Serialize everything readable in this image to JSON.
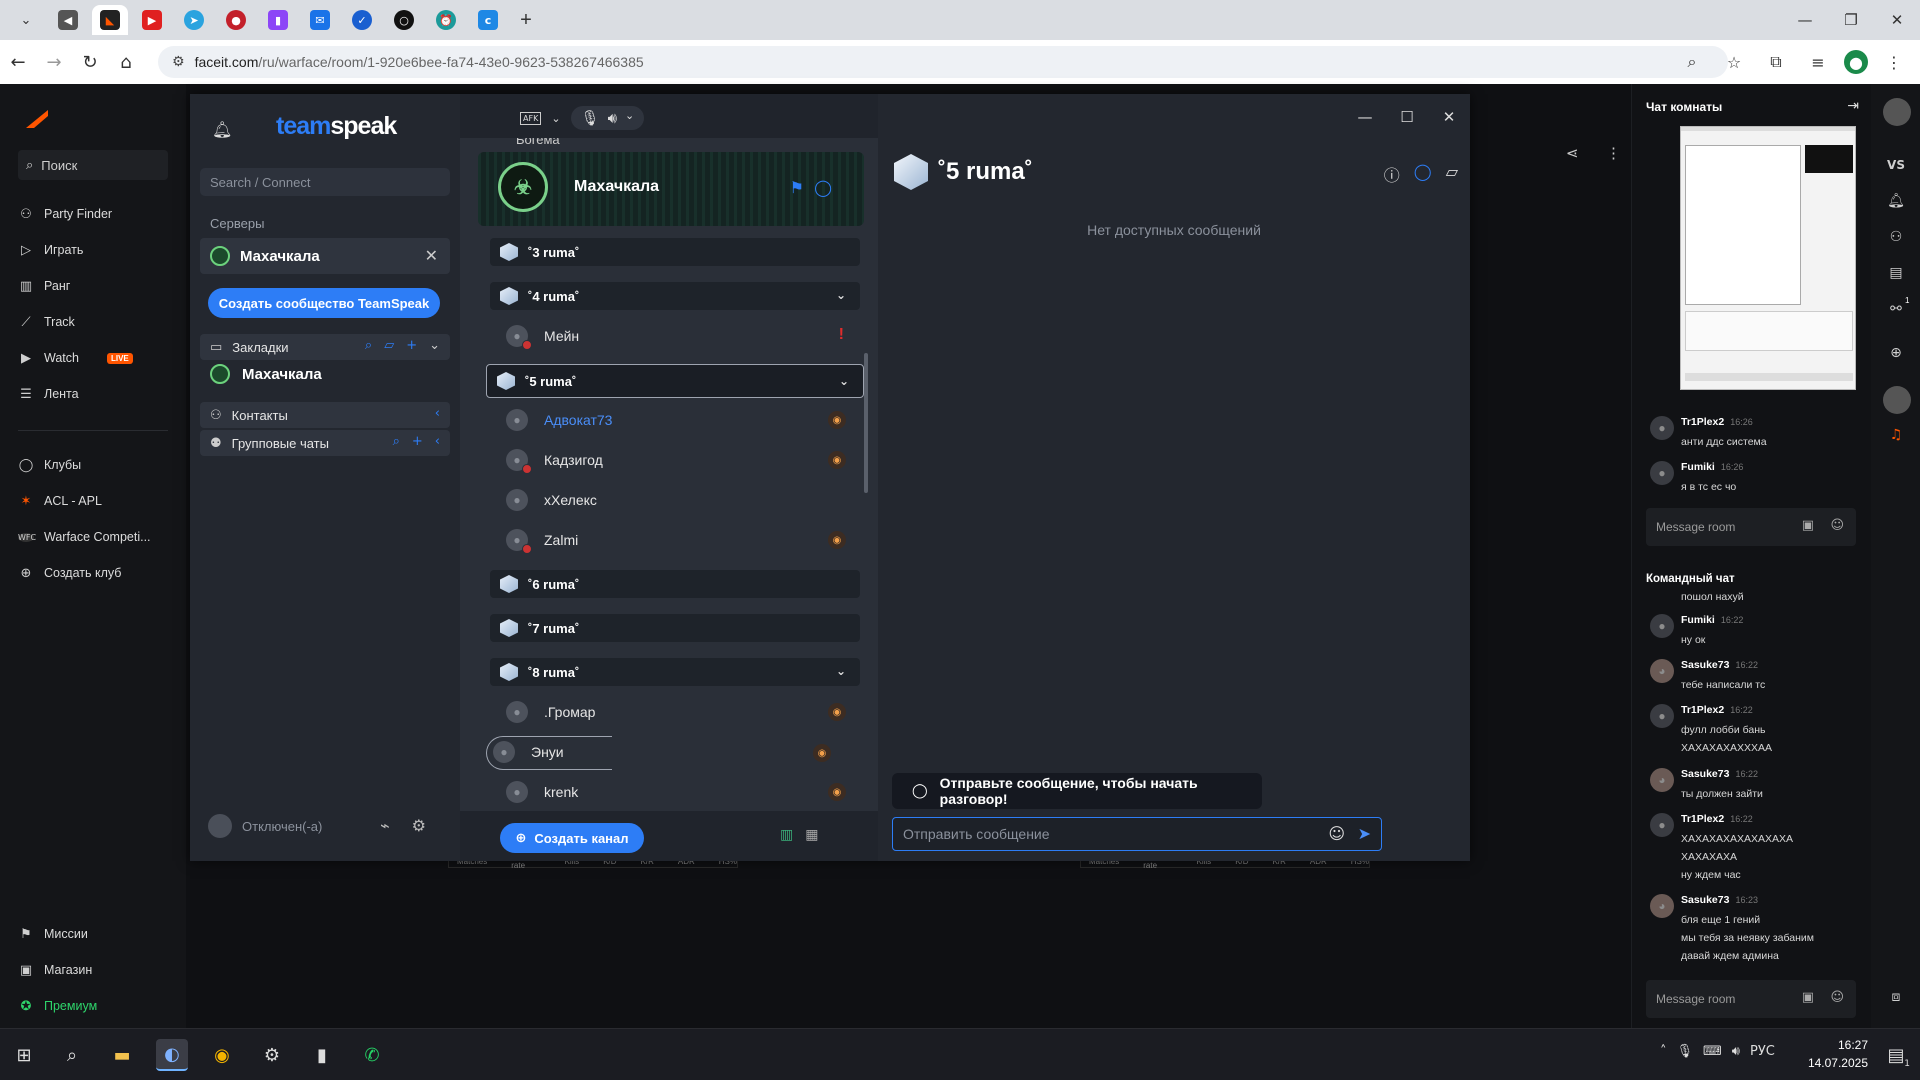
{
  "browser": {
    "url_host": "faceit.com",
    "url_path": "/ru/warface/room/1-920e6bee-fa74-43e0-9623-538267466385"
  },
  "faceit": {
    "search_label": "Поиск",
    "nav": [
      {
        "icon": "party-icon",
        "label": "Party Finder"
      },
      {
        "icon": "play-icon",
        "label": "Играть"
      },
      {
        "icon": "rank-icon",
        "label": "Ранг"
      },
      {
        "icon": "track-icon",
        "label": "Track"
      },
      {
        "icon": "watch-icon",
        "label": "Watch",
        "badge": "LIVE"
      },
      {
        "icon": "feed-icon",
        "label": "Лента"
      }
    ],
    "clubs": [
      {
        "icon": "clubs-icon",
        "label": "Клубы"
      },
      {
        "icon": "acl-icon",
        "label": "ACL - APL"
      },
      {
        "icon": "wfc-icon",
        "label": "Warface Competi..."
      },
      {
        "icon": "add-club-icon",
        "label": "Создать клуб"
      }
    ],
    "bottom_nav": [
      {
        "icon": "missions-icon",
        "label": "Миссии"
      },
      {
        "icon": "shop-icon",
        "label": "Магазин"
      },
      {
        "icon": "premium-icon",
        "label": "Премиум"
      }
    ],
    "stat_headers": [
      "Matches",
      "Win rate",
      "Kills",
      "K/D",
      "K/R",
      "ADR",
      "HS%"
    ]
  },
  "room_chat": {
    "title": "Чат комнаты",
    "messages": [
      {
        "name": "Tr1Plex2",
        "time": "16:26",
        "text": "анти ддс система"
      },
      {
        "name": "Fumiki",
        "time": "16:26",
        "text": "я в тс ес чо"
      }
    ],
    "input_placeholder": "Message room"
  },
  "team_chat": {
    "title": "Командный чат",
    "cut_text": "пошол нахуй",
    "messages": [
      {
        "name": "Fumiki",
        "time": "16:22",
        "lines": [
          "ну ок"
        ],
        "avatar": "default"
      },
      {
        "name": "Sasuke73",
        "time": "16:22",
        "lines": [
          "тебе написали тс"
        ],
        "avatar": "anime"
      },
      {
        "name": "Tr1Plex2",
        "time": "16:22",
        "lines": [
          "фулл лобби бань",
          "ХАХАХАХАХХХАА"
        ],
        "avatar": "default"
      },
      {
        "name": "Sasuke73",
        "time": "16:22",
        "lines": [
          "ты должен зайти"
        ],
        "avatar": "anime"
      },
      {
        "name": "Tr1Plex2",
        "time": "16:22",
        "lines": [
          "ХАХАХАХАХАХАХАХА",
          "ХАХАХАХА",
          "ну ждем час"
        ],
        "avatar": "default"
      },
      {
        "name": "Sasuke73",
        "time": "16:23",
        "lines": [
          "бля еще 1 гений",
          "мы тебя за неявку забаним",
          "давай ждем админа"
        ],
        "avatar": "anime"
      }
    ],
    "input_placeholder": "Message room"
  },
  "rail": {
    "vs_label": "VS",
    "badge": "1"
  },
  "teamspeak": {
    "logo_a": "team",
    "logo_b": "speak",
    "search_placeholder": "Search / Connect",
    "servers_label": "Серверы",
    "server_name": "Махачкала",
    "create_community": "Создать сообщество TeamSpeak",
    "bookmarks_label": "Закладки",
    "bookmark_server": "Махачкала",
    "contacts_label": "Контакты",
    "group_chats_label": "Групповые чаты",
    "status": "Отключен(-а)",
    "afk_label": "AFK",
    "banner_name": "Махачкала",
    "cut_channel": "Богема",
    "channels": [
      {
        "name": "˚3 ruma˚",
        "expanded": false
      },
      {
        "name": "˚4 ruma˚",
        "expanded": true,
        "users": [
          {
            "name": "Мейн",
            "mute": true,
            "warn": true
          }
        ]
      },
      {
        "name": "˚5 ruma˚",
        "expanded": true,
        "selected": true,
        "users": [
          {
            "name": "Адвокат73",
            "blue": true,
            "badge": true
          },
          {
            "name": "Кадзигод",
            "mute": true,
            "badge": true
          },
          {
            "name": "хХелекс"
          },
          {
            "name": "Zalmi",
            "mute": true,
            "badge": true
          }
        ]
      },
      {
        "name": "˚6 ruma˚",
        "expanded": false
      },
      {
        "name": "˚7 ruma˚",
        "expanded": false
      },
      {
        "name": "˚8 ruma˚",
        "expanded": true,
        "users": [
          {
            "name": ".Громар",
            "badge": true
          },
          {
            "name": "Энуи",
            "badge": true,
            "highlight": true
          },
          {
            "name": "krenk",
            "badge": true
          }
        ]
      }
    ],
    "create_channel": "Создать канал",
    "current_channel": "˚5 ruma˚",
    "no_messages": "Нет доступных сообщений",
    "hint": "Отправьте сообщение, чтобы начать разговор!",
    "message_placeholder": "Отправить сообщение"
  },
  "taskbar": {
    "lang": "РУС",
    "time": "16:27",
    "date": "14.07.2025",
    "notif_count": "1"
  }
}
